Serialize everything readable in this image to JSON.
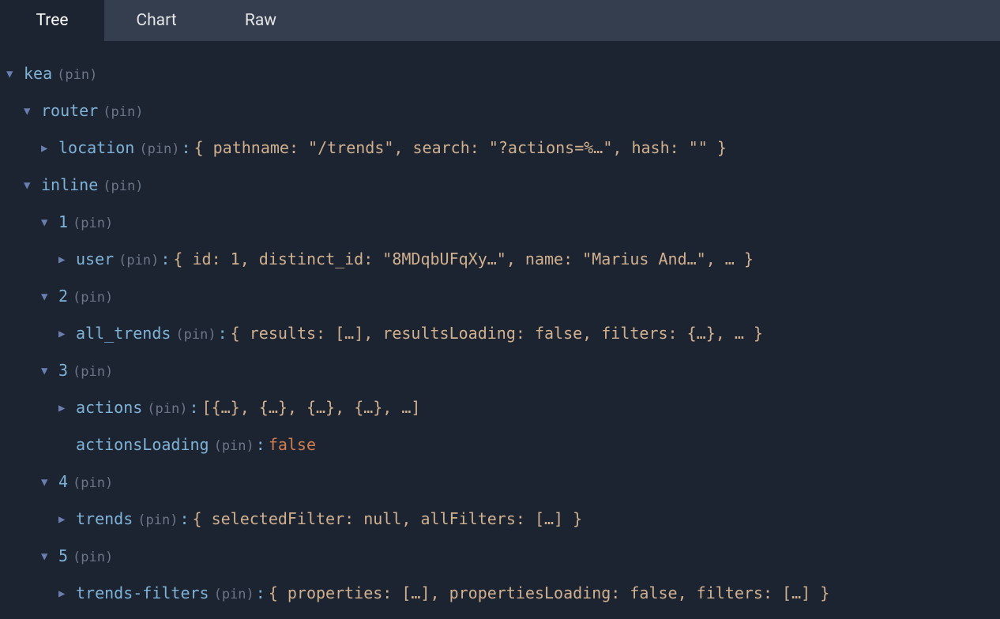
{
  "tabs": [
    {
      "label": "Tree",
      "active": true
    },
    {
      "label": "Chart",
      "active": false
    },
    {
      "label": "Raw",
      "active": false
    }
  ],
  "pin": "(pin)",
  "colon": ":",
  "arrows": {
    "down": "▼",
    "right": "▶"
  },
  "tree": {
    "root_key": "kea",
    "router_key": "router",
    "location_key": "location",
    "location_val": "{ pathname: \"/trends\", search: \"?actions=%…\", hash: \"\" }",
    "inline_key": "inline",
    "n1": "1",
    "user_key": "user",
    "user_val": "{ id: 1, distinct_id: \"8MDqbUFqXy…\", name: \"Marius And…\", … }",
    "n2": "2",
    "all_trends_key": "all_trends",
    "all_trends_val": "{ results: […], resultsLoading: false, filters: {…}, … }",
    "n3": "3",
    "actions_key": "actions",
    "actions_val": "[{…}, {…}, {…}, {…}, …]",
    "actions_loading_key": "actionsLoading",
    "actions_loading_val": "false",
    "n4": "4",
    "trends_key": "trends",
    "trends_val": "{ selectedFilter: null, allFilters: […] }",
    "n5": "5",
    "trends_filters_key": "trends-filters",
    "trends_filters_val": "{ properties: […], propertiesLoading: false, filters: […] }"
  }
}
